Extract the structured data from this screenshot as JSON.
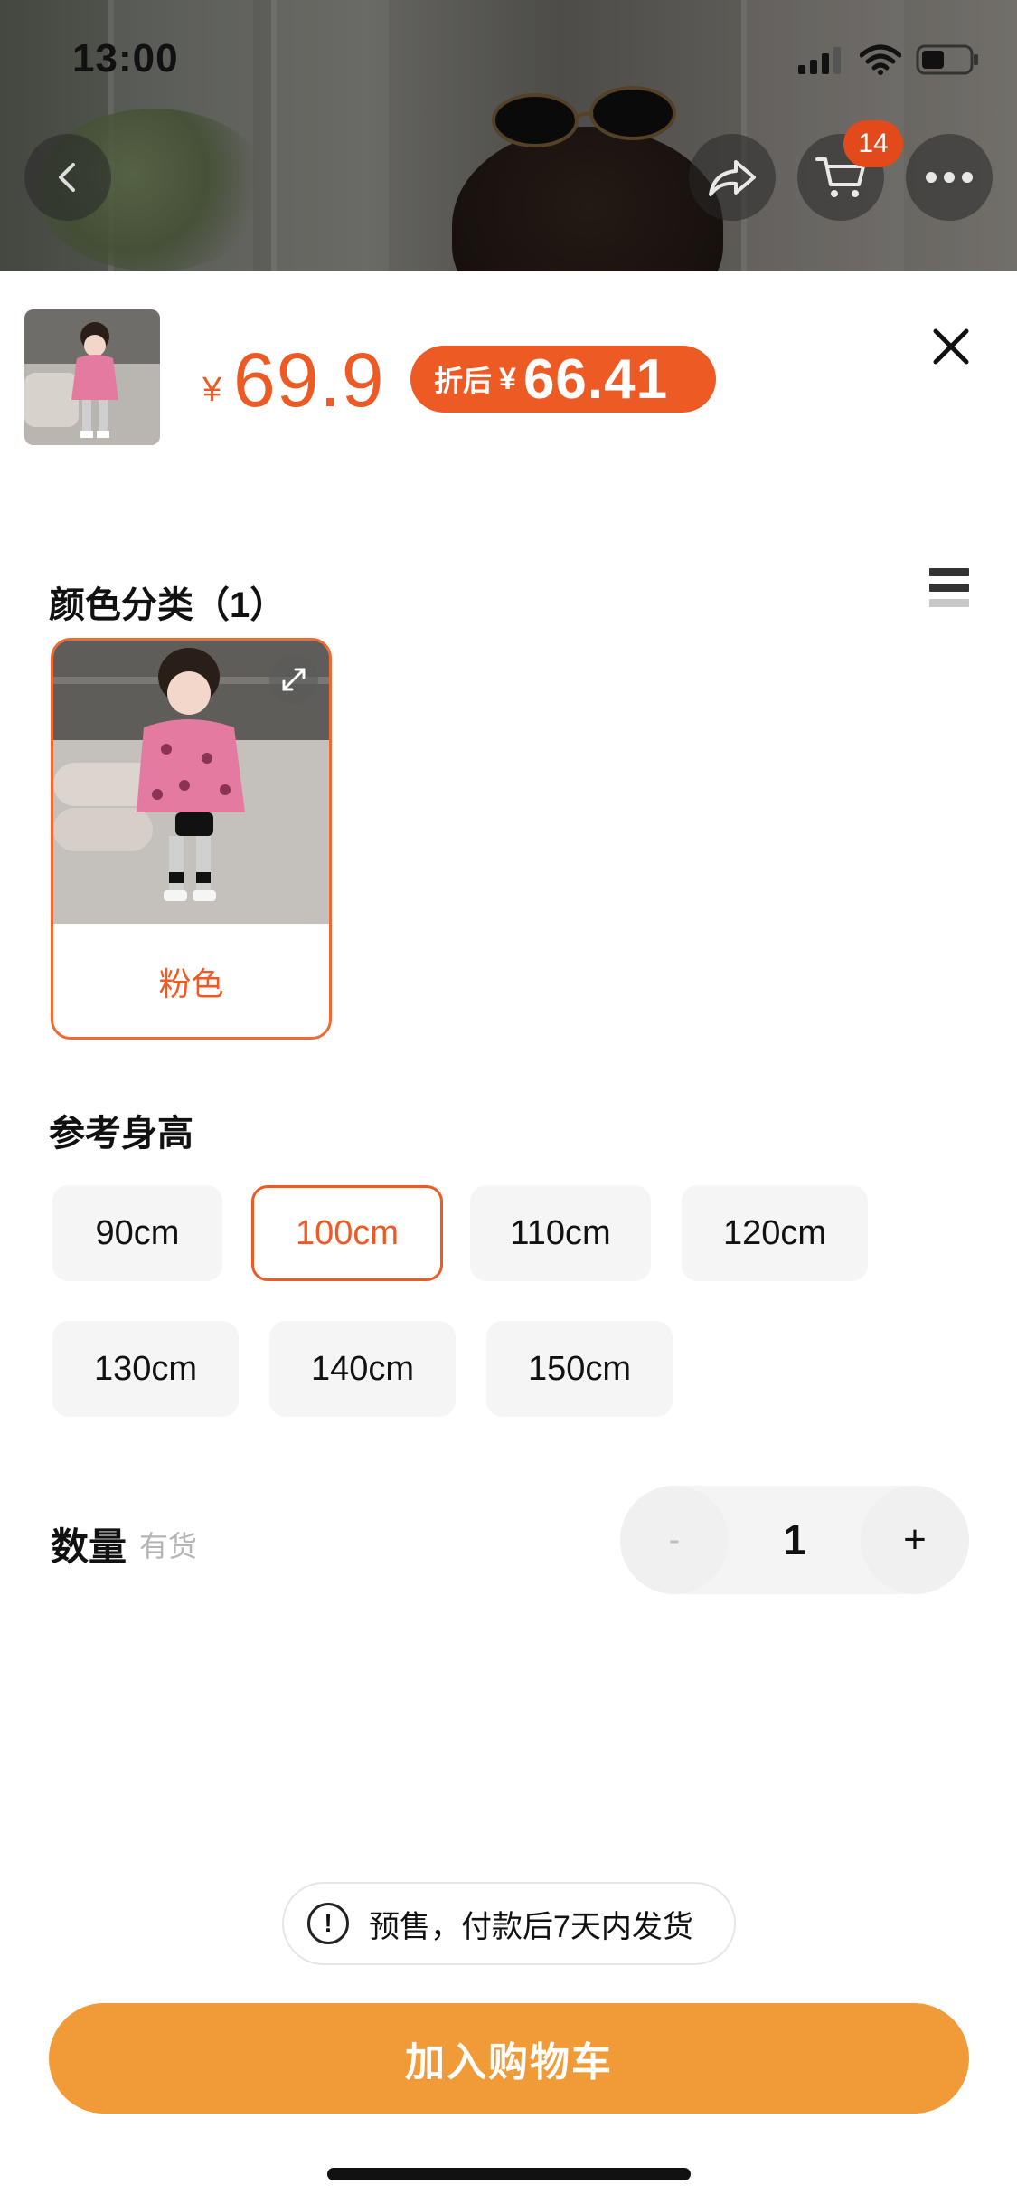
{
  "status_bar": {
    "time": "13:00"
  },
  "top_nav": {
    "cart_badge": "14"
  },
  "product": {
    "price_symbol": "¥",
    "price": "69.9",
    "discount_label": "折后",
    "discount_symbol": "¥",
    "discount_price": "66.41"
  },
  "color_section": {
    "title": "颜色分类（1）",
    "options": [
      {
        "label": "粉色",
        "selected": true
      }
    ]
  },
  "size_section": {
    "title": "参考身高",
    "options": [
      {
        "label": "90cm",
        "selected": false
      },
      {
        "label": "100cm",
        "selected": true
      },
      {
        "label": "110cm",
        "selected": false
      },
      {
        "label": "120cm",
        "selected": false
      },
      {
        "label": "130cm",
        "selected": false
      },
      {
        "label": "140cm",
        "selected": false
      },
      {
        "label": "150cm",
        "selected": false
      }
    ]
  },
  "quantity": {
    "label": "数量",
    "stock": "有货",
    "minus": "-",
    "value": "1",
    "plus": "+"
  },
  "notice": {
    "text": "预售，付款后7天内发货"
  },
  "cta": {
    "label": "加入购物车"
  },
  "colors": {
    "accent": "#ee5a24",
    "cta": "#f19a38",
    "chip_bg": "#f5f5f5"
  }
}
